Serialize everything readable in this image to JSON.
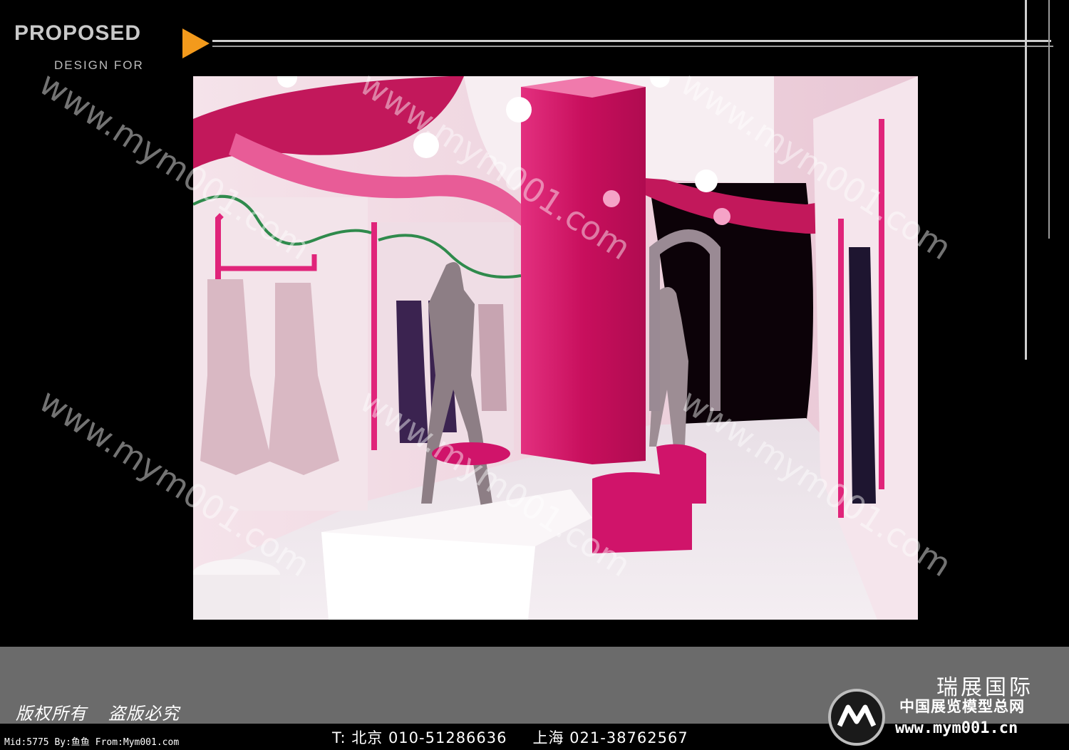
{
  "header": {
    "title": "PROPOSED",
    "subtitle": "DESIGN FOR"
  },
  "colors": {
    "accent_orange": "#f39a1c",
    "magenta": "#d81b6e",
    "footer_gray": "#6b6b6b"
  },
  "watermark": {
    "text": "www.mym001.com"
  },
  "footer": {
    "copyright_1": "版权所有",
    "copyright_2": "盗版必究",
    "meta": "Mid:5775 By:鱼鱼 From:Mym001.com",
    "contact_beijing": "T: 北京 010-51286636",
    "contact_shanghai": "上海 021-38762567",
    "brand_name": "瑞展国际",
    "brand_sub": "中国展览模型总网",
    "brand_url": "www.mym001.cn",
    "logo_icon": "mym-logo-icon"
  }
}
